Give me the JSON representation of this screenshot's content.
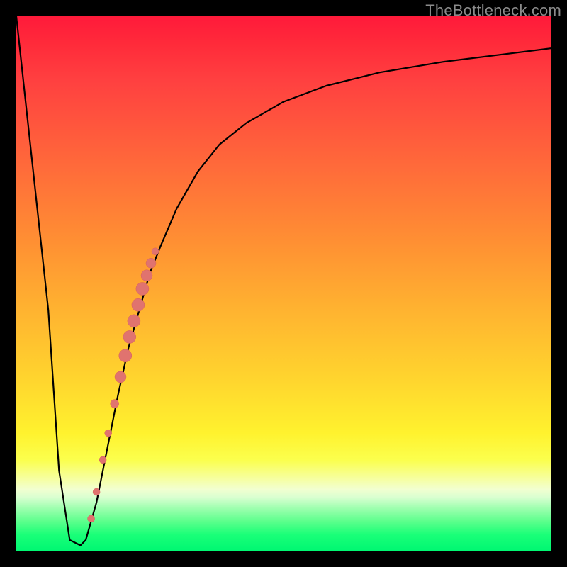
{
  "watermark": "TheBottleneck.com",
  "colors": {
    "curve_stroke": "#000000",
    "dot_fill": "#e0736f",
    "dot_stroke": "#d85f5a"
  },
  "chart_data": {
    "type": "line",
    "title": "",
    "xlabel": "",
    "ylabel": "",
    "xlim": [
      0,
      100
    ],
    "ylim": [
      0,
      100
    ],
    "series": [
      {
        "name": "bottleneck-curve",
        "x": [
          0,
          6,
          8,
          10,
          12,
          13,
          15,
          17,
          19,
          21,
          23,
          25,
          27,
          30,
          34,
          38,
          43,
          50,
          58,
          68,
          80,
          92,
          100
        ],
        "y": [
          100,
          45,
          15,
          2,
          1,
          2,
          9,
          19,
          29,
          38,
          45,
          52,
          57,
          64,
          71,
          76,
          80,
          84,
          87,
          89.5,
          91.5,
          93,
          94
        ]
      }
    ],
    "dots": {
      "name": "highlighted-points",
      "points": [
        {
          "x": 14.0,
          "y": 6.0,
          "r": 5
        },
        {
          "x": 15.0,
          "y": 11.0,
          "r": 5
        },
        {
          "x": 16.2,
          "y": 17.0,
          "r": 5
        },
        {
          "x": 17.2,
          "y": 22.0,
          "r": 5
        },
        {
          "x": 18.4,
          "y": 27.5,
          "r": 6
        },
        {
          "x": 19.5,
          "y": 32.5,
          "r": 8
        },
        {
          "x": 20.4,
          "y": 36.5,
          "r": 9
        },
        {
          "x": 21.2,
          "y": 40.0,
          "r": 9
        },
        {
          "x": 22.0,
          "y": 43.0,
          "r": 9
        },
        {
          "x": 22.8,
          "y": 46.0,
          "r": 9
        },
        {
          "x": 23.6,
          "y": 49.0,
          "r": 9
        },
        {
          "x": 24.4,
          "y": 51.5,
          "r": 8
        },
        {
          "x": 25.2,
          "y": 53.8,
          "r": 7
        },
        {
          "x": 26.0,
          "y": 56.0,
          "r": 5
        }
      ]
    }
  }
}
